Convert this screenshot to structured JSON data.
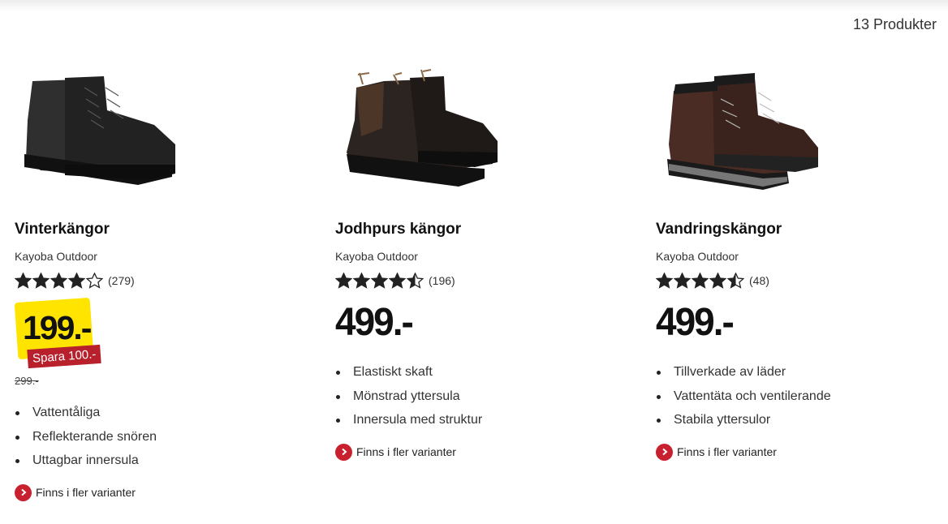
{
  "header": {
    "product_count": "13 Produkter"
  },
  "products": [
    {
      "name": "Vinterkängor",
      "brand": "Kayoba Outdoor",
      "rating_stars": 4,
      "rating_count": "(279)",
      "sale_price": "199.-",
      "save_label": "Spara 100.-",
      "old_price": "299.-",
      "features": [
        "Vattentåliga",
        "Reflekterande snören",
        "Uttagbar innersula"
      ],
      "variants_label": "Finns i fler varianter"
    },
    {
      "name": "Jodhpurs kängor",
      "brand": "Kayoba Outdoor",
      "rating_stars": 4.5,
      "rating_count": "(196)",
      "price": "499.-",
      "features": [
        "Elastiskt skaft",
        "Mönstrad yttersula",
        "Innersula med struktur"
      ],
      "variants_label": "Finns i fler varianter"
    },
    {
      "name": "Vandringskängor",
      "brand": "Kayoba Outdoor",
      "rating_stars": 4.5,
      "rating_count": "(48)",
      "price": "499.-",
      "features": [
        "Tillverkade av läder",
        "Vattentäta och ventilerande",
        "Stabila yttersulor"
      ],
      "variants_label": "Finns i fler varianter"
    }
  ],
  "colors": {
    "sale_yellow": "#ffe400",
    "accent_red": "#c8202e",
    "save_red": "#b8202c"
  }
}
